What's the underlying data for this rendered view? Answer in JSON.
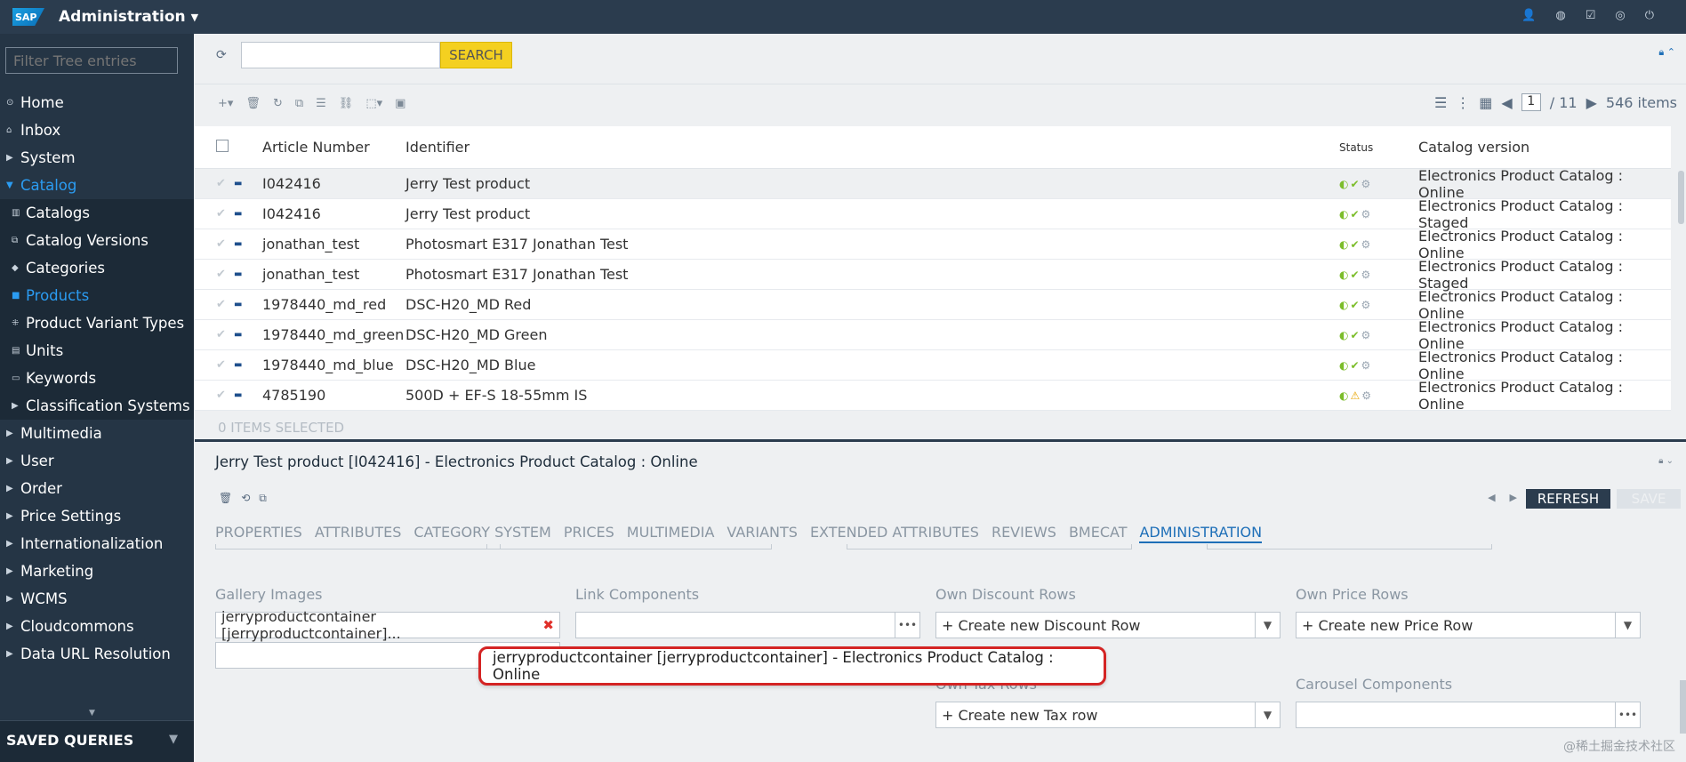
{
  "app": {
    "logo": "SAP",
    "title": "Administration"
  },
  "top_icons": [
    "user-icon",
    "globe-icon",
    "task-icon",
    "help-icon",
    "power-icon"
  ],
  "sidebar": {
    "filter_placeholder": "Filter Tree entries",
    "items": [
      {
        "label": "Home",
        "icon": "home-icon",
        "level": 0
      },
      {
        "label": "Inbox",
        "icon": "inbox-icon",
        "level": 0
      },
      {
        "label": "System",
        "icon": "caret-right",
        "level": 0
      },
      {
        "label": "Catalog",
        "icon": "caret-down",
        "level": 0,
        "active": true
      },
      {
        "label": "Catalogs",
        "icon": "catalog-icon",
        "level": 1
      },
      {
        "label": "Catalog Versions",
        "icon": "version-icon",
        "level": 1
      },
      {
        "label": "Categories",
        "icon": "tag-icon",
        "level": 1
      },
      {
        "label": "Products",
        "icon": "product-icon",
        "level": 1,
        "active": true
      },
      {
        "label": "Product Variant Types",
        "icon": "variant-icon",
        "level": 1
      },
      {
        "label": "Units",
        "icon": "units-icon",
        "level": 1
      },
      {
        "label": "Keywords",
        "icon": "keywords-icon",
        "level": 1
      },
      {
        "label": "Classification Systems",
        "icon": "caret-right",
        "level": 1
      },
      {
        "label": "Multimedia",
        "icon": "caret-right",
        "level": 0
      },
      {
        "label": "User",
        "icon": "caret-right",
        "level": 0
      },
      {
        "label": "Order",
        "icon": "caret-right",
        "level": 0
      },
      {
        "label": "Price Settings",
        "icon": "caret-right",
        "level": 0
      },
      {
        "label": "Internationalization",
        "icon": "caret-right",
        "level": 0
      },
      {
        "label": "Marketing",
        "icon": "caret-right",
        "level": 0
      },
      {
        "label": "WCMS",
        "icon": "caret-right",
        "level": 0
      },
      {
        "label": "Cloudcommons",
        "icon": "caret-right",
        "level": 0
      },
      {
        "label": "Data URL Resolution",
        "icon": "caret-right",
        "level": 0
      }
    ],
    "saved_queries": "SAVED QUERIES"
  },
  "search": {
    "value": "",
    "button": "SEARCH"
  },
  "pager": {
    "page": "1",
    "total": "/ 11",
    "items": "546 items"
  },
  "table": {
    "columns": [
      "Article Number",
      "Identifier",
      "Status",
      "Catalog version"
    ],
    "rows": [
      {
        "article": "I042416",
        "identifier": "Jerry Test product",
        "status": [
          "ok",
          "ok",
          "none"
        ],
        "catalog": "Electronics Product Catalog : Online"
      },
      {
        "article": "I042416",
        "identifier": "Jerry Test product",
        "status": [
          "ok",
          "ok",
          "none"
        ],
        "catalog": "Electronics Product Catalog : Staged"
      },
      {
        "article": "jonathan_test",
        "identifier": "Photosmart E317 Jonathan Test",
        "status": [
          "ok",
          "ok",
          "none"
        ],
        "catalog": "Electronics Product Catalog : Online"
      },
      {
        "article": "jonathan_test",
        "identifier": "Photosmart E317 Jonathan Test",
        "status": [
          "ok",
          "ok",
          "none"
        ],
        "catalog": "Electronics Product Catalog : Staged"
      },
      {
        "article": "1978440_md_red",
        "identifier": "DSC-H20_MD Red",
        "status": [
          "ok",
          "ok",
          "none"
        ],
        "catalog": "Electronics Product Catalog : Online"
      },
      {
        "article": "1978440_md_green",
        "identifier": "DSC-H20_MD Green",
        "status": [
          "ok",
          "ok",
          "none"
        ],
        "catalog": "Electronics Product Catalog : Online"
      },
      {
        "article": "1978440_md_blue",
        "identifier": "DSC-H20_MD Blue",
        "status": [
          "ok",
          "ok",
          "none"
        ],
        "catalog": "Electronics Product Catalog : Online"
      },
      {
        "article": "4785190",
        "identifier": "500D + EF-S 18-55mm IS",
        "status": [
          "ok",
          "warn",
          "none"
        ],
        "catalog": "Electronics Product Catalog : Online"
      }
    ]
  },
  "selection": "0 ITEMS SELECTED",
  "editor": {
    "title": "Jerry Test product [I042416] - Electronics Product Catalog : Online",
    "refresh": "REFRESH",
    "save": "SAVE",
    "tabs": [
      "PROPERTIES",
      "ATTRIBUTES",
      "CATEGORY SYSTEM",
      "PRICES",
      "MULTIMEDIA",
      "VARIANTS",
      "EXTENDED ATTRIBUTES",
      "REVIEWS",
      "BMECAT",
      "ADMINISTRATION"
    ],
    "active_tab": "ADMINISTRATION",
    "fields": {
      "gallery_label": "Gallery Images",
      "gallery_value": "jerryproductcontainer [jerryproductcontainer]...",
      "link_label": "Link Components",
      "discount_label": "Own Discount Rows",
      "discount_value": "+ Create new Discount Row",
      "price_label": "Own Price Rows",
      "price_value": "+ Create new Price Row",
      "tax_label": "Own Tax Rows",
      "tax_value": "+ Create new Tax row",
      "carousel_label": "Carousel Components"
    },
    "tooltip": "jerryproductcontainer [jerryproductcontainer] - Electronics Product Catalog : Online"
  },
  "colors": {
    "topbar": "#2b3c4e",
    "sidebar": "#253545",
    "accent": "#1e6fb8",
    "search_button": "#f4d020",
    "highlight": "#d42424"
  },
  "watermark": "@稀土掘金技术社区"
}
